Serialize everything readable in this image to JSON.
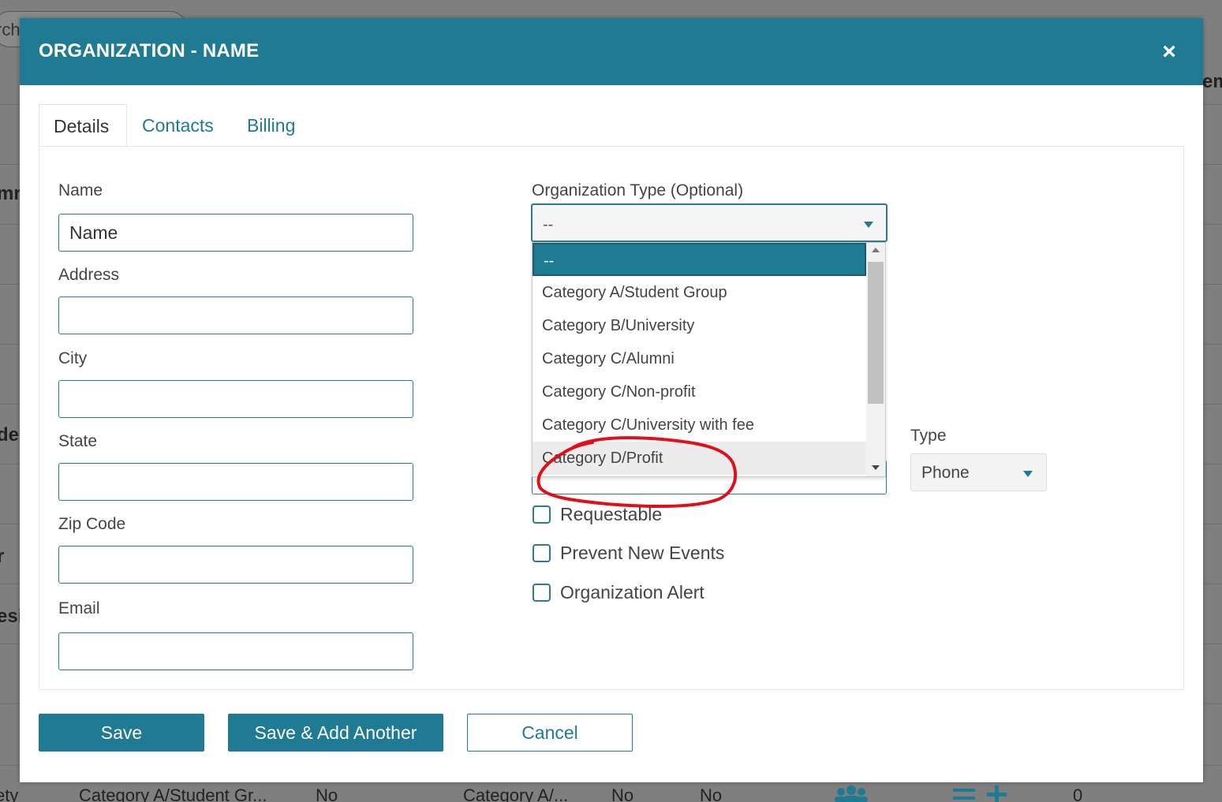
{
  "background": {
    "search_text": "rch",
    "left_fragments": [
      "mr",
      "de",
      "r",
      "esi"
    ],
    "right_fragment": "em",
    "bottom_row": [
      "ety",
      "Category A/Student Gr...",
      "No",
      "Category A/...",
      "No",
      "No",
      "0"
    ]
  },
  "modal": {
    "title": "ORGANIZATION - NAME",
    "close_glyph": "×"
  },
  "tabs": [
    {
      "label": "Details"
    },
    {
      "label": "Contacts"
    },
    {
      "label": "Billing"
    }
  ],
  "fields": {
    "name": {
      "label": "Name",
      "value": "Name"
    },
    "address": {
      "label": "Address",
      "value": ""
    },
    "city": {
      "label": "City",
      "value": ""
    },
    "state": {
      "label": "State",
      "value": ""
    },
    "zip": {
      "label": "Zip Code",
      "value": ""
    },
    "email": {
      "label": "Email",
      "value": ""
    }
  },
  "org_type": {
    "label": "Organization Type (Optional)",
    "selected": "--",
    "options": [
      "--",
      "Category A/Student Group",
      "Category B/University",
      "Category C/Alumni",
      "Category C/Non-profit",
      "Category C/University with fee",
      "Category D/Profit"
    ]
  },
  "phone_type": {
    "label": "Type",
    "selected": "Phone"
  },
  "checkboxes": [
    {
      "label": "Requestable",
      "checked": false
    },
    {
      "label": "Prevent New Events",
      "checked": false
    },
    {
      "label": "Organization Alert",
      "checked": false
    }
  ],
  "buttons": {
    "save": "Save",
    "save_add": "Save & Add Another",
    "cancel": "Cancel"
  },
  "colors": {
    "primary": "#1f7a93",
    "annotation": "#e0101a"
  }
}
